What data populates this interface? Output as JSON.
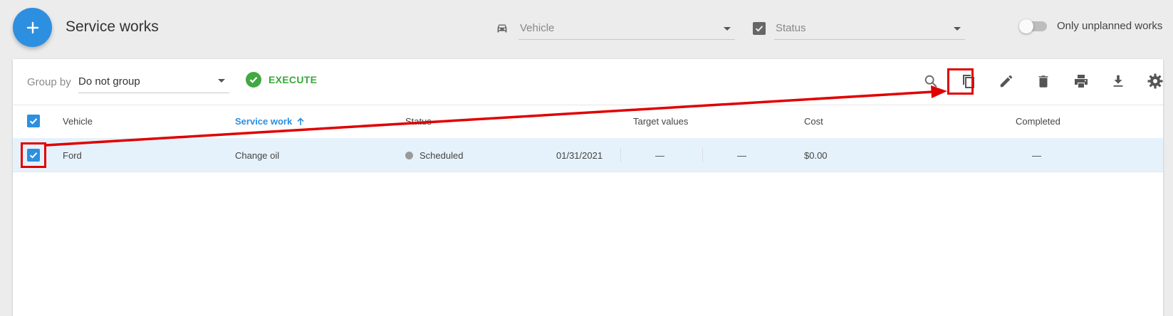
{
  "header": {
    "title": "Service works",
    "add_button": "+",
    "vehicle_filter_placeholder": "Vehicle",
    "status_filter_placeholder": "Status",
    "only_unplanned_label": "Only unplanned works"
  },
  "toolbar": {
    "group_by_label": "Group by",
    "group_by_value": "Do not group",
    "execute_label": "EXECUTE",
    "icons": [
      "search-icon",
      "copy-icon",
      "edit-icon",
      "delete-icon",
      "print-icon",
      "download-icon",
      "settings-icon"
    ]
  },
  "table": {
    "columns": {
      "vehicle": "Vehicle",
      "service_work": "Service work",
      "status": "Status",
      "target_values": "Target values",
      "cost": "Cost",
      "completed": "Completed"
    },
    "rows": [
      {
        "vehicle": "Ford",
        "service_work": "Change oil",
        "status": "Scheduled",
        "date": "01/31/2021",
        "target_1": "—",
        "target_2": "—",
        "cost": "$0.00",
        "completed": "—"
      }
    ]
  },
  "colors": {
    "accent": "#2d8fe0",
    "execute_green": "#43a843",
    "annotation_red": "#e00000",
    "selected_row": "#e6f2fb"
  }
}
